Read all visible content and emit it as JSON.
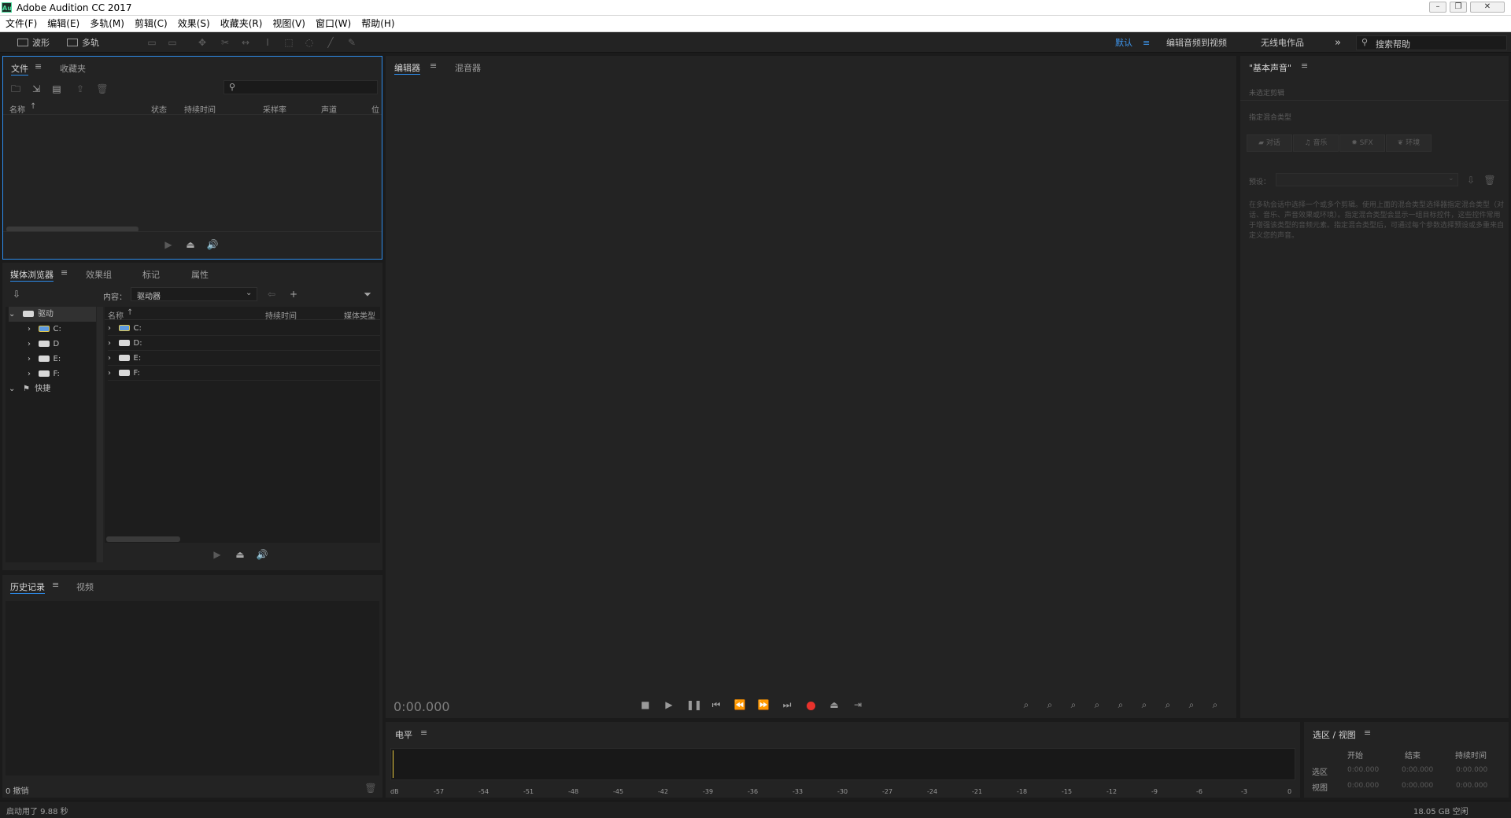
{
  "window": {
    "title": "Adobe Audition CC 2017",
    "logo": "Au"
  },
  "menu": [
    "文件(F)",
    "编辑(E)",
    "多轨(M)",
    "剪辑(C)",
    "效果(S)",
    "收藏夹(R)",
    "视图(V)",
    "窗口(W)",
    "帮助(H)"
  ],
  "toolbar": {
    "waveform": "波形",
    "multitrack": "多轨",
    "workspaces": [
      "默认",
      "编辑音频到视频",
      "无线电作品"
    ],
    "search_placeholder": "搜索帮助"
  },
  "files_panel": {
    "tabs": [
      "文件",
      "收藏夹"
    ],
    "columns": [
      "名称",
      "状态",
      "持续时间",
      "采样率",
      "声道",
      "位"
    ]
  },
  "media_panel": {
    "tabs": [
      "媒体浏览器",
      "效果组",
      "标记",
      "属性"
    ],
    "content_label": "内容：",
    "content_value": "驱动器",
    "tree": [
      {
        "label": "驱动"
      },
      {
        "label": "C:"
      },
      {
        "label": "D"
      },
      {
        "label": "E:"
      },
      {
        "label": "F:"
      },
      {
        "label": "快捷"
      }
    ],
    "columns": [
      "名称",
      "持续时间",
      "媒体类型"
    ],
    "rows": [
      "C:",
      "D:",
      "E:",
      "F:"
    ]
  },
  "history_panel": {
    "tabs": [
      "历史记录",
      "视频"
    ],
    "undo_count": "0 撤销"
  },
  "editor": {
    "tabs": [
      "编辑器",
      "混音器"
    ],
    "time": "0:00.000"
  },
  "essential_sound": {
    "title": "\"基本声音\"",
    "no_clip": "未选定剪辑",
    "assign_type": "指定混合类型",
    "types": [
      "对话",
      "音乐",
      "SFX",
      "环境"
    ],
    "preset_label": "预设：",
    "help": "在多轨会话中选择一个或多个剪辑。使用上面的混合类型选择器指定混合类型（对话、音乐、声音效果或环境）。指定混合类型会显示一组目标控件，这些控件常用于增强该类型的音频元素。指定混合类型后，可通过每个参数选择预设或多重来自定义您的声音。"
  },
  "levels": {
    "title": "电平",
    "ticks": [
      "dB",
      "-57",
      "-54",
      "-51",
      "-48",
      "-45",
      "-42",
      "-39",
      "-36",
      "-33",
      "-30",
      "-27",
      "-24",
      "-21",
      "-18",
      "-15",
      "-12",
      "-9",
      "-6",
      "-3",
      "0"
    ]
  },
  "selection_view": {
    "title": "选区 / 视图",
    "columns": [
      "开始",
      "结束",
      "持续时间"
    ],
    "rows": [
      {
        "label": "选区",
        "values": [
          "0:00.000",
          "0:00.000",
          "0:00.000"
        ]
      },
      {
        "label": "视图",
        "values": [
          "0:00.000",
          "0:00.000",
          "0:00.000"
        ]
      }
    ]
  },
  "status": {
    "left": "启动用了 9.88 秒",
    "right": "18.05 GB 空闲"
  },
  "colors": {
    "accent": "#2d8ceb",
    "record": "#e8322c",
    "level_cursor": "#e8c840"
  }
}
